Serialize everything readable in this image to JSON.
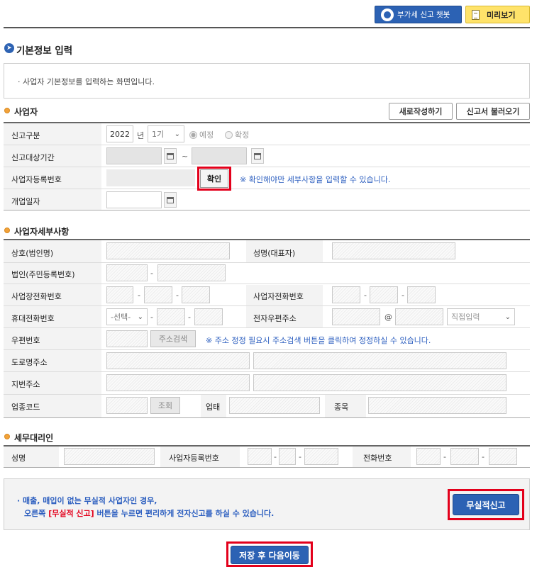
{
  "top_buttons": {
    "chatbot": "부가세 신고 챗봇",
    "preview": "미리보기"
  },
  "page_title": "기본정보 입력",
  "notice": "· 사업자 기본정보를 입력하는 화면입니다.",
  "sections": {
    "business": {
      "title": "사업자",
      "btn_new": "새로작성하기",
      "btn_load": "신고서 불러오기",
      "labels": {
        "report_type": "신고구분",
        "period": "신고대상기간",
        "reg_no": "사업자등록번호",
        "open_date": "개업일자"
      },
      "year": "2022",
      "year_unit": "년",
      "term": "1기",
      "radio_planned": "예정",
      "radio_final": "확정",
      "tilde": "~",
      "confirm": "확인",
      "confirm_hint": "※ 확인해야만 세부사항을 입력할 수 있습니다."
    },
    "details": {
      "title": "사업자세부사항",
      "labels": {
        "company": "상호(법인명)",
        "ceo": "성명(대표자)",
        "corp_no": "법인(주민등록번호)",
        "biz_phone": "사업장전화번호",
        "biz_tel": "사업자전화번호",
        "mobile": "휴대전화번호",
        "email": "전자우편주소",
        "zip": "우편번호",
        "road_addr": "도로명주소",
        "lot_addr": "지번주소",
        "ind_code": "업종코드",
        "biz_type": "업태",
        "biz_item": "종목"
      },
      "mobile_select": "-선택-",
      "email_domain": "직접입력",
      "at": "@",
      "dash": "-",
      "addr_search": "주소검색",
      "addr_hint": "※ 주소 정정 필요시 주소검색 버튼을 클릭하여 정정하실 수 있습니다.",
      "lookup": "조회"
    },
    "agent": {
      "title": "세무대리인",
      "labels": {
        "name": "성명",
        "reg_no": "사업자등록번호",
        "phone": "전화번호"
      }
    }
  },
  "bottom": {
    "note1": "· 매출, 매입이 없는 무실적 사업자인 경우,",
    "note2_a": "오른쪽 ",
    "note2_red": "[무실적 신고]",
    "note2_b": " 버튼을 누르면 편리하게 전자신고를 하실 수 있습니다.",
    "btn_no_record": "무실적신고",
    "btn_save_next": "저장 후 다음이동"
  },
  "colors": {
    "accent_blue": "#2c62b4",
    "highlight_red": "#e3001b",
    "section_orange": "#f2a23a",
    "preview_yellow": "#ffe36a"
  }
}
